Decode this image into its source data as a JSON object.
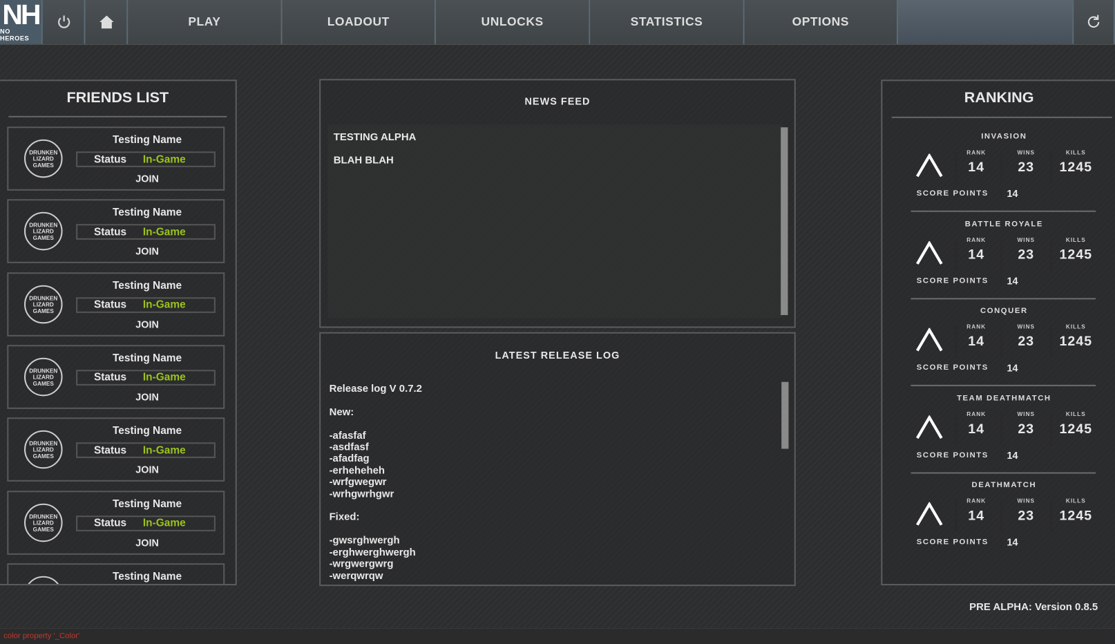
{
  "nav": {
    "logo": "NH",
    "logo_sub": "NO HEROES",
    "items": [
      "PLAY",
      "LOADOUT",
      "UNLOCKS",
      "STATISTICS",
      "OPTIONS"
    ]
  },
  "friends": {
    "title": "FRIENDS LIST",
    "avatar_text": "DRUNKEN LIZARD GAMES",
    "items": [
      {
        "name": "Testing Name",
        "status_label": "Status",
        "status": "In-Game",
        "action": "JOIN"
      },
      {
        "name": "Testing Name",
        "status_label": "Status",
        "status": "In-Game",
        "action": "JOIN"
      },
      {
        "name": "Testing Name",
        "status_label": "Status",
        "status": "In-Game",
        "action": "JOIN"
      },
      {
        "name": "Testing Name",
        "status_label": "Status",
        "status": "In-Game",
        "action": "JOIN"
      },
      {
        "name": "Testing Name",
        "status_label": "Status",
        "status": "In-Game",
        "action": "JOIN"
      },
      {
        "name": "Testing Name",
        "status_label": "Status",
        "status": "In-Game",
        "action": "JOIN"
      },
      {
        "name": "Testing Name"
      }
    ]
  },
  "news": {
    "title": "NEWS FEED",
    "items": [
      "TESTING ALPHA",
      "BLAH BLAH"
    ]
  },
  "release": {
    "title": "LATEST RELEASE LOG",
    "body": "Release log V 0.7.2\n\nNew:\n\n-afasfaf\n-asdfasf\n-afadfag\n-erheheheh\n-wrfgwegwr\n-wrhgwrhgwr\n\nFixed:\n\n-gwsrghwergh\n-erghwerghwergh\n-wrgwergwrg\n-werqwrqw"
  },
  "ranking": {
    "title": "RANKING",
    "labels": {
      "rank": "RANK",
      "wins": "WINS",
      "kills": "KILLS",
      "score": "SCORE POINTS"
    },
    "modes": [
      {
        "name": "INVASION",
        "rank": "14",
        "wins": "23",
        "kills": "1245",
        "score": "14"
      },
      {
        "name": "BATTLE ROYALE",
        "rank": "14",
        "wins": "23",
        "kills": "1245",
        "score": "14"
      },
      {
        "name": "CONQUER",
        "rank": "14",
        "wins": "23",
        "kills": "1245",
        "score": "14"
      },
      {
        "name": "TEAM DEATHMATCH",
        "rank": "14",
        "wins": "23",
        "kills": "1245",
        "score": "14"
      },
      {
        "name": "DEATHMATCH",
        "rank": "14",
        "wins": "23",
        "kills": "1245",
        "score": "14"
      }
    ]
  },
  "version": "PRE ALPHA: Version 0.8.5",
  "console": "color property '_Color'",
  "colors": {
    "status": "#9bc31c",
    "console": "#c0392b"
  }
}
